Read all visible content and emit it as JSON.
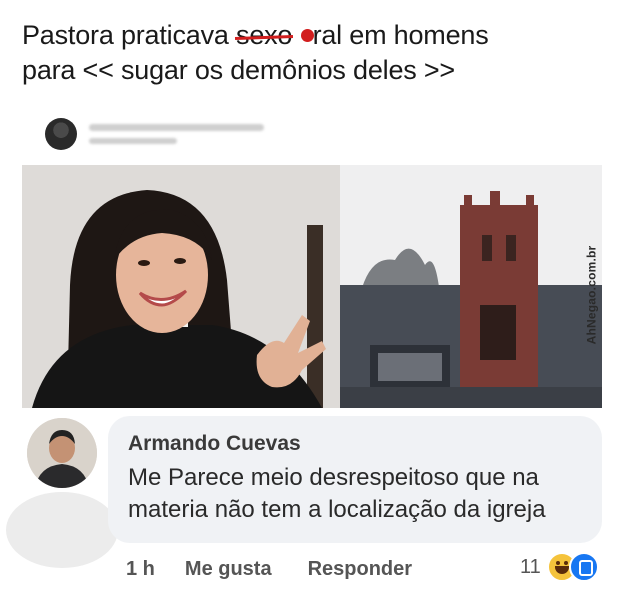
{
  "headline": {
    "part1": "Pastora praticava ",
    "struck_word": "sexo",
    "part2": " ",
    "part3": "ral em homens",
    "line2": "para << sugar os demônios deles >>"
  },
  "watermark": "AhNegao.com.br",
  "comment": {
    "author": "Armando Cuevas",
    "text": "Me Parece meio desrespeitoso que na materia não tem a localização da igreja",
    "time": "1 h",
    "like_label": "Me gusta",
    "reply_label": "Responder",
    "reaction_count": "11",
    "reaction_icons": [
      "haha-emoji-icon",
      "like-reaction-icon"
    ]
  },
  "colors": {
    "accent_red": "#d21e1e",
    "bubble_bg": "#f0f2f5",
    "fb_blue": "#1877f2"
  }
}
